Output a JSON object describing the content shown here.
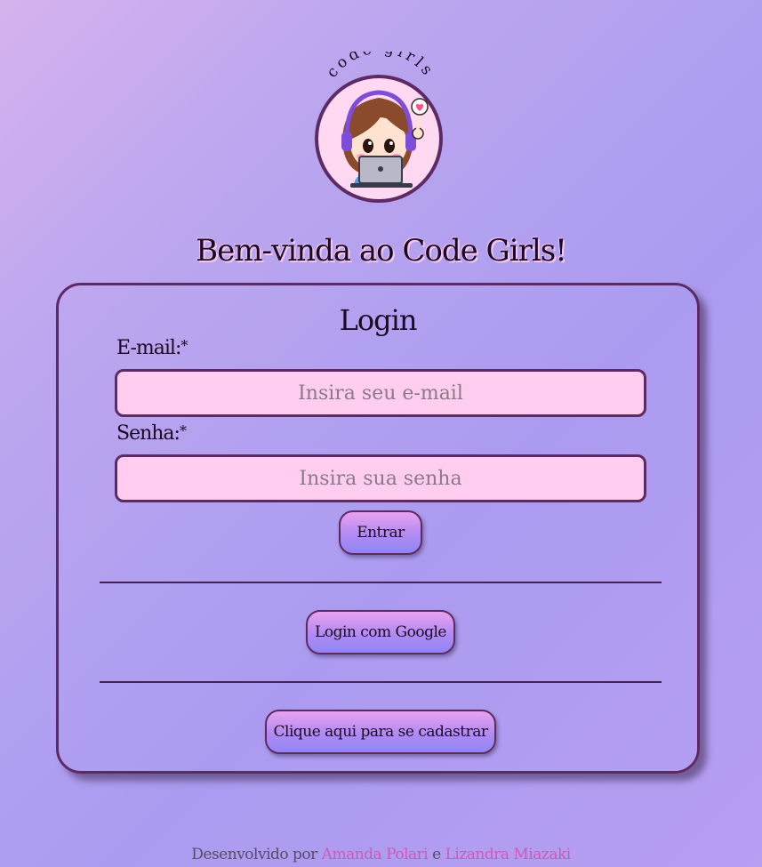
{
  "logo": {
    "arc_text": "code girls",
    "icon": "coding-girl-avatar-icon",
    "colors": {
      "ring": "#5e2a64",
      "face": "#ffd9f2",
      "hair": "#8a4a2c",
      "headset": "#7d4cd8",
      "shirt": "#4f9ee6",
      "laptop": "#b8b8c8",
      "heart": "#ff4f8e"
    }
  },
  "header": {
    "welcome": "Bem-vinda ao Code Girls!"
  },
  "login": {
    "title": "Login",
    "email_label": "E-mail:",
    "email_required_mark": "*",
    "email_placeholder": "Insira seu e-mail",
    "email_value": "",
    "password_label": "Senha:",
    "password_required_mark": "*",
    "password_placeholder": "Insira sua senha",
    "password_value": "",
    "submit_label": "Entrar",
    "google_label": "Login com Google",
    "signup_label": "Clique aqui para se cadastrar"
  },
  "footer": {
    "prefix": "Desenvolvido por ",
    "author_1": "Amanda Polari",
    "joiner": " e ",
    "author_2": "Lizandra Miazaki"
  },
  "theme": {
    "card_border": "#5e2a64",
    "input_bg": "#ffcdf0",
    "link_color": "#d257b8"
  }
}
